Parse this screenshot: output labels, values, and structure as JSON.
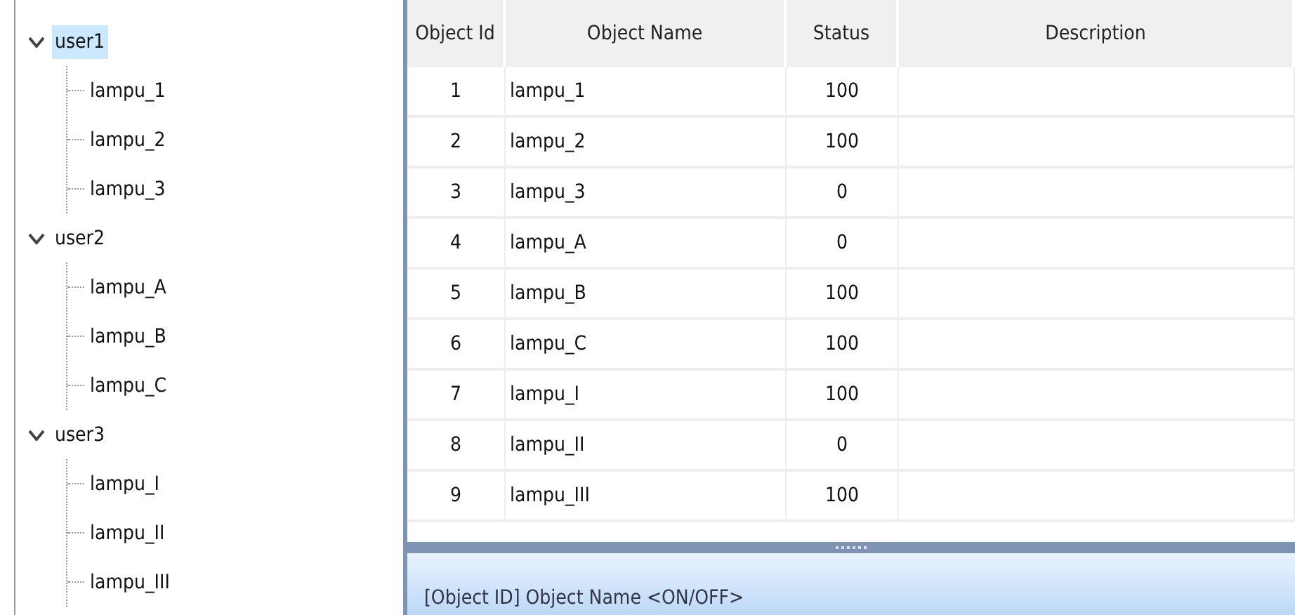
{
  "tree": [
    {
      "label": "user1",
      "expanded": true,
      "selected": true,
      "children": [
        {
          "label": "lampu_1",
          "selected": false
        },
        {
          "label": "lampu_2",
          "selected": false
        },
        {
          "label": "lampu_3",
          "selected": false
        }
      ]
    },
    {
      "label": "user2",
      "expanded": true,
      "selected": false,
      "children": [
        {
          "label": "lampu_A",
          "selected": false
        },
        {
          "label": "lampu_B",
          "selected": false
        },
        {
          "label": "lampu_C",
          "selected": false
        }
      ]
    },
    {
      "label": "user3",
      "expanded": true,
      "selected": false,
      "children": [
        {
          "label": "lampu_I",
          "selected": false
        },
        {
          "label": "lampu_II",
          "selected": false
        },
        {
          "label": "lampu_III",
          "selected": false
        }
      ]
    }
  ],
  "table": {
    "columns": [
      "Object Id",
      "Object Name",
      "Status",
      "Description"
    ],
    "rows": [
      [
        "1",
        "lampu_1",
        "100"
      ],
      [
        "2",
        "lampu_2",
        "100"
      ],
      [
        "3",
        "lampu_3",
        "0"
      ],
      [
        "4",
        "lampu_A",
        "0"
      ],
      [
        "5",
        "lampu_B",
        "100"
      ],
      [
        "6",
        "lampu_C",
        "100"
      ],
      [
        "7",
        "lampu_I",
        "100"
      ],
      [
        "8",
        "lampu_II",
        "0"
      ],
      [
        "9",
        "lampu_III",
        "100"
      ]
    ]
  },
  "format_hint": "[Object ID] Object Name <ON/OFF>"
}
